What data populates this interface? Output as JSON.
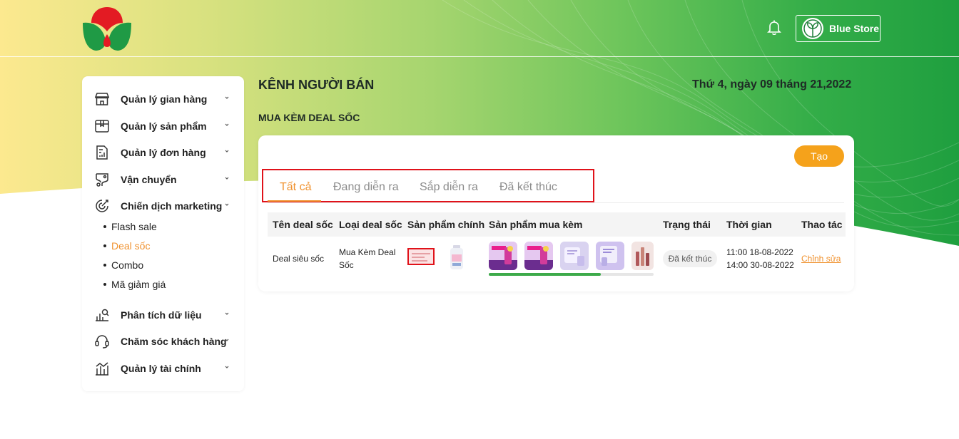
{
  "header": {
    "store_name": "Blue Store",
    "logo_icon": "brand-logo",
    "bell_icon": "bell-icon"
  },
  "sidebar": {
    "items": [
      {
        "label": "Quản lý gian hàng",
        "icon": "store-icon"
      },
      {
        "label": "Quản lý sản phẩm",
        "icon": "box-icon"
      },
      {
        "label": "Quản lý đơn hàng",
        "icon": "order-report-icon"
      },
      {
        "label": "Vận chuyển",
        "icon": "shipping-route-icon"
      },
      {
        "label": "Chiến dịch marketing",
        "icon": "target-icon"
      },
      {
        "label": "Phân tích dữ liệu",
        "icon": "data-analysis-icon"
      },
      {
        "label": "Chăm sóc khách hàng",
        "icon": "headset-icon"
      },
      {
        "label": "Quản lý tài chính",
        "icon": "finance-chart-icon"
      }
    ],
    "sub_items": [
      {
        "label": "Flash sale"
      },
      {
        "label": "Deal sốc",
        "active": true
      },
      {
        "label": "Combo"
      },
      {
        "label": "Mã giảm giá"
      }
    ]
  },
  "main": {
    "title": "KÊNH NGƯỜI BÁN",
    "date": "Thứ 4, ngày 09 tháng 21,2022",
    "section_title": "MUA KÈM DEAL SỐC",
    "create_label": "Tạo",
    "tabs": [
      {
        "label": "Tất cả",
        "active": true
      },
      {
        "label": "Đang diễn ra"
      },
      {
        "label": "Sắp diễn ra"
      },
      {
        "label": "Đã kết thúc"
      }
    ],
    "table": {
      "headers": [
        "Tên deal sốc",
        "Loại deal sốc",
        "Sản phẩm chính",
        "Sản phẩm mua kèm",
        "Trạng thái",
        "Thời gian",
        "Thao tác"
      ],
      "rows": [
        {
          "name": "Deal siêu sốc",
          "type_line1": "Mua Kèm Deal",
          "type_line2": "Sốc",
          "status": "Đã kết thúc",
          "time_start": "11:00 18-08-2022",
          "time_end": "14:00 30-08-2022",
          "action": "Chỉnh sửa",
          "addon_progress": 0.68
        }
      ]
    }
  },
  "colors": {
    "accent": "#f0922f",
    "create_button": "#f5a21b",
    "highlight_box": "#e0121a",
    "progress": "#3daa4a"
  }
}
